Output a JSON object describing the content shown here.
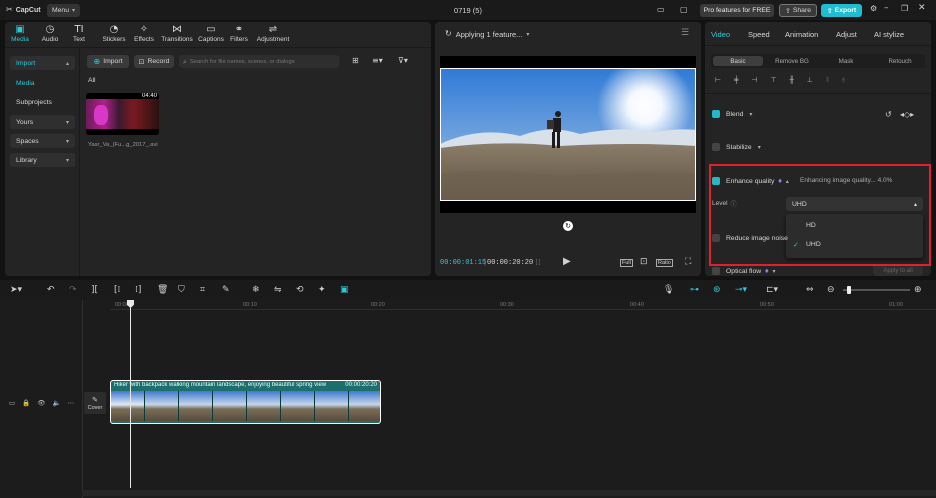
{
  "app": {
    "logo": "CapCut",
    "menu_label": "Menu",
    "project_title": "0719 (5)",
    "pro_label": "Pro features for FREE",
    "share_label": "Share",
    "export_label": "Export"
  },
  "toolbar_tabs": [
    {
      "label": "Media",
      "icon": "media-icon"
    },
    {
      "label": "Audio",
      "icon": "audio-icon"
    },
    {
      "label": "Text",
      "icon": "text-icon"
    },
    {
      "label": "Stickers",
      "icon": "stickers-icon"
    },
    {
      "label": "Effects",
      "icon": "effects-icon"
    },
    {
      "label": "Transitions",
      "icon": "transitions-icon"
    },
    {
      "label": "Captions",
      "icon": "captions-icon"
    },
    {
      "label": "Filters",
      "icon": "filters-icon"
    },
    {
      "label": "Adjustment",
      "icon": "adjustment-icon"
    }
  ],
  "sidebar": {
    "import": "Import",
    "media": "Media",
    "subprojects": "Subprojects",
    "yours": "Yours",
    "spaces": "Spaces",
    "library": "Library"
  },
  "media_panel": {
    "import_btn": "Import",
    "record_btn": "Record",
    "search_placeholder": "Search for file names, scenes, or dialogs",
    "filter_all": "All",
    "clip_duration": "04:40",
    "clip_name": "Yasr_Va_(Fu...g_2017_.avi"
  },
  "player": {
    "status": "Applying 1 feature...",
    "current_time": "00:00:01:15",
    "total_time": "00:00:20:20",
    "full_label": "Full",
    "ratio_label": "Ratio"
  },
  "inspector": {
    "tabs": [
      "Video",
      "Speed",
      "Animation",
      "Adjust",
      "AI stylize"
    ],
    "subtabs": [
      "Basic",
      "Remove BG",
      "Mask",
      "Retouch"
    ],
    "blend": "Blend",
    "stabilize": "Stabilize",
    "enhance_quality": "Enhance quality",
    "enhancing_status": "Enhancing image quality... 4.0%",
    "level_label": "Level",
    "level_value": "UHD",
    "options": [
      "HD",
      "UHD"
    ],
    "reduce_noise": "Reduce image noise",
    "optical_flow": "Optical flow",
    "apply_all": "Apply to all"
  },
  "timeline": {
    "ticks": [
      "00:00",
      "00:10",
      "00:20",
      "00:30",
      "00:40",
      "00:50",
      "01:00"
    ],
    "clip_title": "Hiker with backpack walking mountain landscape, enjoying beautiful spring view",
    "clip_duration": "00:00:20:20",
    "cover_label": "Cover"
  },
  "colors": {
    "accent": "#22b8c8",
    "highlight_box": "#e0202c"
  }
}
